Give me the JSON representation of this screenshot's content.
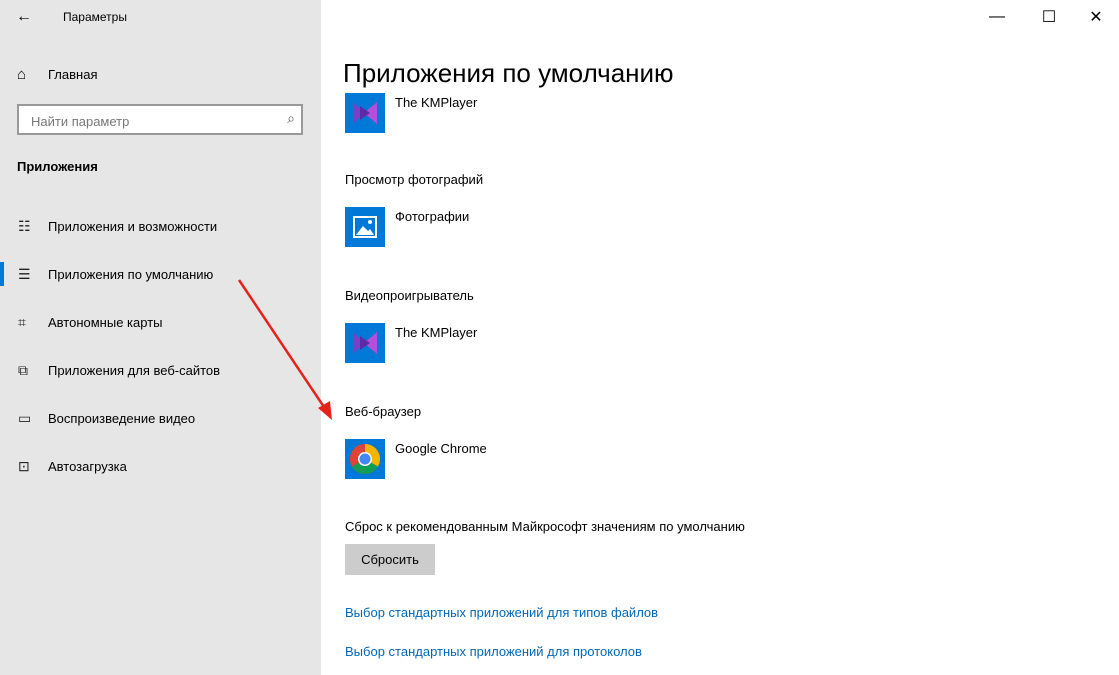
{
  "window": {
    "title": "Параметры",
    "back_icon": "←",
    "controls": {
      "minimize": "—",
      "maximize": "☐",
      "close": "✕"
    }
  },
  "sidebar": {
    "home_label": "Главная",
    "home_icon": "⌂",
    "search_placeholder": "Найти параметр",
    "search_icon": "⌕",
    "section_title": "Приложения",
    "items": [
      {
        "label": "Приложения и возможности",
        "icon": "☷"
      },
      {
        "label": "Приложения по умолчанию",
        "icon": "☰",
        "active": true
      },
      {
        "label": "Автономные карты",
        "icon": "⌗"
      },
      {
        "label": "Приложения для веб-сайтов",
        "icon": "⧉"
      },
      {
        "label": "Воспроизведение видео",
        "icon": "▭"
      },
      {
        "label": "Автозагрузка",
        "icon": "⊡"
      }
    ]
  },
  "main": {
    "title": "Приложения по умолчанию",
    "top_app": "The KMPlayer",
    "sections": [
      {
        "label": "Просмотр фотографий",
        "app": "Фотографии"
      },
      {
        "label": "Видеопроигрыватель",
        "app": "The KMPlayer"
      },
      {
        "label": "Веб-браузер",
        "app": "Google Chrome"
      }
    ],
    "reset_label": "Сброс к рекомендованным Майкрософт значениям по умолчанию",
    "reset_button": "Сбросить",
    "links": [
      "Выбор стандартных приложений для типов файлов",
      "Выбор стандартных приложений для протоколов"
    ]
  },
  "colors": {
    "accent": "#0078d7",
    "link": "#0067b8",
    "sidebar_bg": "#e6e6e6",
    "annotation_arrow": "#e5231b"
  }
}
